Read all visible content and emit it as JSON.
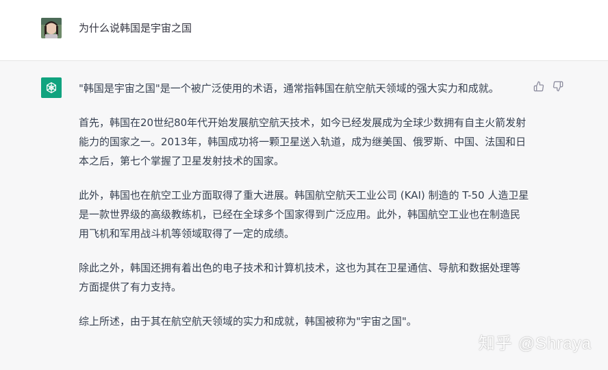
{
  "user_message": {
    "text": "为什么说韩国是宇宙之国"
  },
  "assistant_message": {
    "paragraphs": [
      "\"韩国是宇宙之国\"是一个被广泛使用的术语，通常指韩国在航空航天领域的强大实力和成就。",
      "首先，韩国在20世纪80年代开始发展航空航天技术，如今已经发展成为全球少数拥有自主火箭发射能力的国家之一。2013年，韩国成功将一颗卫星送入轨道，成为继美国、俄罗斯、中国、法国和日本之后，第七个掌握了卫星发射技术的国家。",
      "此外，韩国也在航空工业方面取得了重大进展。韩国航空航天工业公司 (KAI) 制造的 T-50 人造卫星是一款世界级的高级教练机，已经在全球多个国家得到广泛应用。此外，韩国航空工业也在制造民用飞机和军用战斗机等领域取得了一定的成绩。",
      "除此之外，韩国还拥有着出色的电子技术和计算机技术，这也为其在卫星通信、导航和数据处理等方面提供了有力支持。",
      "综上所述，由于其在航空航天领域的实力和成就，韩国被称为\"宇宙之国\"。"
    ]
  },
  "icons": {
    "user_avatar": "user-avatar-photo",
    "assistant_avatar": "openai-logo-icon",
    "like": "thumbs-up-icon",
    "dislike": "thumbs-down-icon"
  },
  "colors": {
    "assistant_bg": "#f7f7f8",
    "avatar_green": "#10a37f",
    "text": "#374151"
  },
  "watermark": {
    "text": "知乎 @Shraya"
  }
}
